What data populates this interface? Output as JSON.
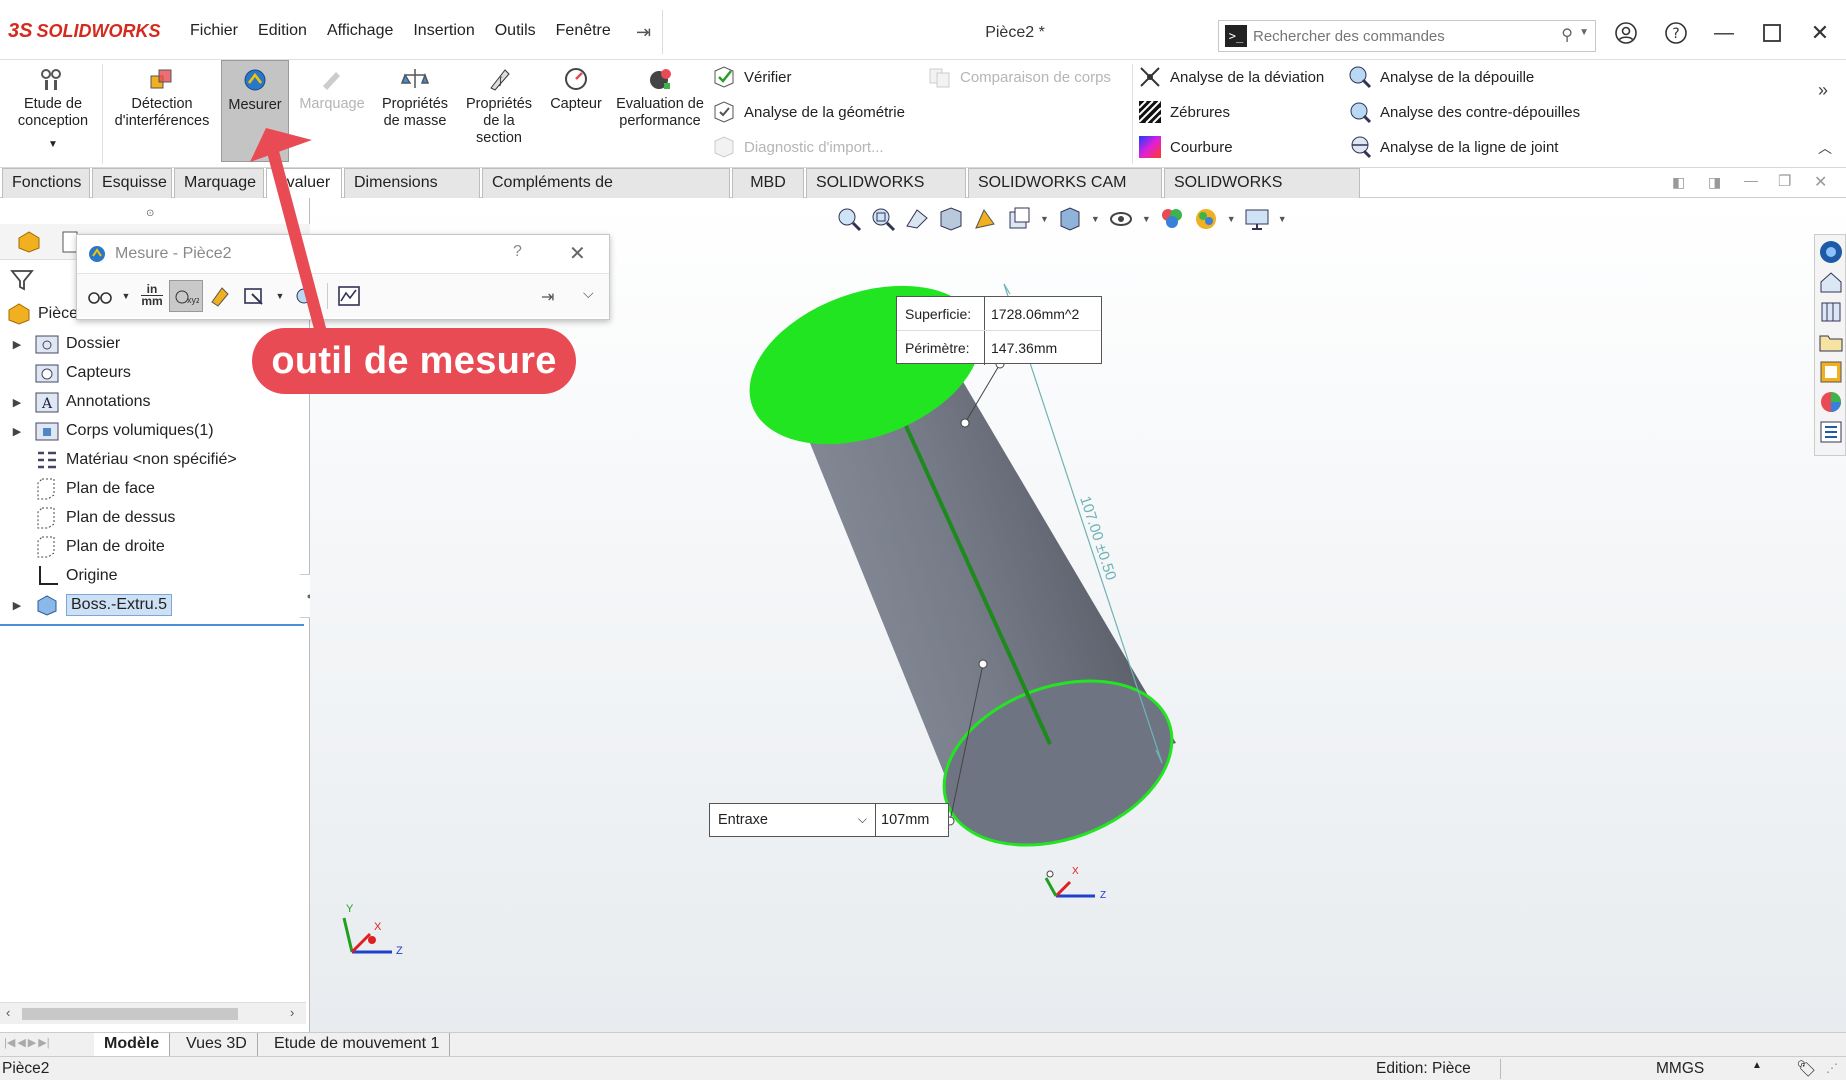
{
  "app": {
    "brand": "SOLIDWORKS",
    "brand_prefix": "3S",
    "document_title": "Pièce2 *",
    "menu": [
      "Fichier",
      "Edition",
      "Affichage",
      "Insertion",
      "Outils",
      "Fenêtre"
    ],
    "search_placeholder": "Rechercher des commandes"
  },
  "ribbon": {
    "etude": "Etude de conception",
    "detection": "Détection d'interférences",
    "mesurer": "Mesurer",
    "marquage": "Marquage",
    "proprietes_masse": "Propriétés de masse",
    "proprietes_section": "Propriétés de la section",
    "capteur": "Capteur",
    "evaluation": "Evaluation de performance",
    "verifier": "Vérifier",
    "analyse_geometrie": "Analyse de la géométrie",
    "diagnostic": "Diagnostic d'import...",
    "comparaison": "Comparaison de corps",
    "analyse_deviation": "Analyse de la déviation",
    "zebrures": "Zébrures",
    "courbure": "Courbure",
    "analyse_depouille": "Analyse de la dépouille",
    "analyse_contre_depouilles": "Analyse des contre-dépouilles",
    "analyse_ligne_joint": "Analyse de la ligne de joint"
  },
  "tabs": [
    "Fonctions",
    "Esquisse",
    "Marquage",
    "Evaluer",
    "Dimensions MBD",
    "Compléments de SOLIDWORKS",
    "MBD",
    "SOLIDWORKS CAM",
    "SOLIDWORKS CAM TBM",
    "SOLIDWORKS Inspection"
  ],
  "tree": {
    "root": "Pièce2",
    "items": [
      "Dossier",
      "Capteurs",
      "Annotations",
      "Corps volumiques(1)",
      "Matériau <non spécifié>",
      "Plan de face",
      "Plan de dessus",
      "Plan de droite",
      "Origine",
      "Boss.-Extru.5"
    ]
  },
  "measure_dialog": {
    "title": "Mesure - Pièce2",
    "help": "?",
    "units_in": "in",
    "units_mm": "mm"
  },
  "callout": "outil de mesure",
  "annotations": {
    "area_label": "Superficie:",
    "area_value": "1728.06mm^2",
    "perimeter_label": "Périmètre:",
    "perimeter_value": "147.36mm",
    "entraxe_label": "Entraxe",
    "entraxe_value": "107mm",
    "dimension_text": "107.00 ±0.50"
  },
  "triad": {
    "x": "X",
    "y": "Y",
    "z": "Z"
  },
  "bottom_tabs": [
    "Modèle",
    "Vues 3D",
    "Etude de mouvement 1"
  ],
  "status": {
    "left": "Pièce2",
    "mode": "Edition: Pièce",
    "units": "MMGS"
  },
  "colors": {
    "accent_red": "#e94b54",
    "face_green": "#22e522",
    "cylinder_gray": "#6e7381"
  }
}
